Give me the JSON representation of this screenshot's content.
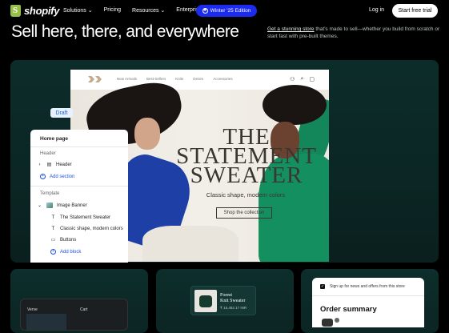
{
  "nav": {
    "logo_text": "shopify",
    "links": [
      "Solutions",
      "Pricing",
      "Resources",
      "Enterprise"
    ],
    "edition_label": "Winter '25 Edition",
    "login": "Log in",
    "trial": "Start free trial"
  },
  "hero": {
    "headline": "Sell here, there, and everywhere",
    "sub_link": "Get a stunning store",
    "sub_rest": " that's made to sell—whether you build from scratch or start fast with pre-built themes."
  },
  "storefront": {
    "links": [
      "New Arrivals",
      "Best-Sellers",
      "Knits",
      "Denim",
      "Accessories"
    ],
    "title_line1": "THE",
    "title_line2": "STATEMENT",
    "title_line3": "SWEATER",
    "tagline": "Classic shape, modern colors",
    "cta": "Shop the collection"
  },
  "editor": {
    "draft": "Draft",
    "panel_title": "Home page",
    "section_header": "Header",
    "header_item": "Header",
    "add_section": "Add section",
    "section_template": "Template",
    "image_banner": "Image Banner",
    "item_title": "The Statement Sweater",
    "item_sub": "Classic shape, modern colors",
    "item_buttons": "Buttons",
    "add_block": "Add block"
  },
  "bottom": {
    "device_brand": "Verve",
    "device_cart": "Cart",
    "product_name_1": "Forest",
    "product_name_2": "Knit Sweater",
    "product_price": "₹ 15,482.17 INR",
    "newsletter": "Sign up for news and offers from this store",
    "order_summary": "Order summary"
  }
}
